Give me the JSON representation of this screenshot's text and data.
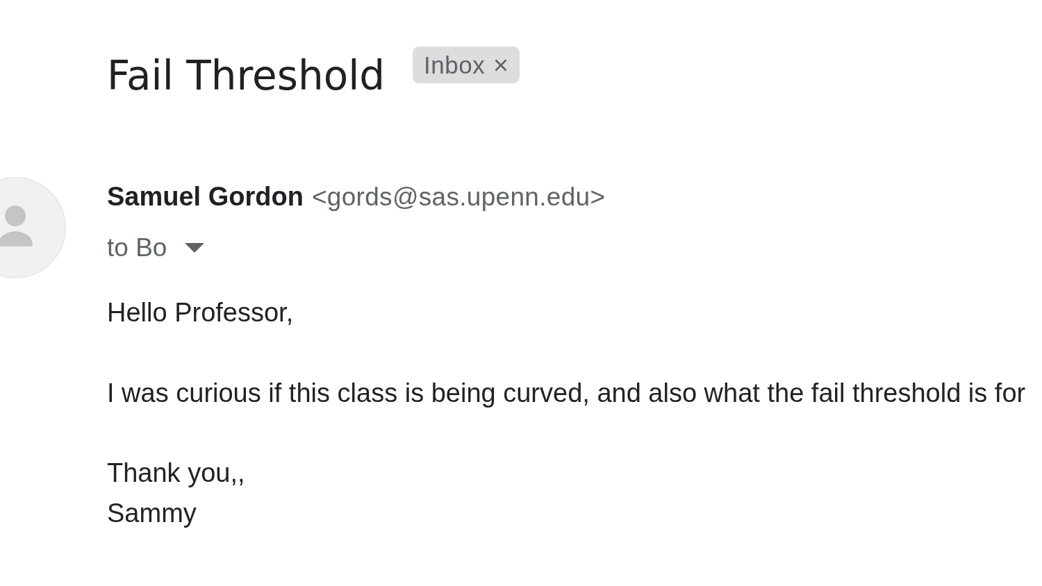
{
  "email": {
    "subject": "Fail Threshold",
    "labels": [
      {
        "text": "Inbox"
      }
    ],
    "sender": {
      "name": "Samuel Gordon",
      "address": "<gords@sas.upenn.edu>"
    },
    "recipients": "to Bo",
    "body": [
      [
        "Hello Professor,"
      ],
      [
        "I was curious if this class is being curved, and also what the fail threshold is for"
      ],
      [
        "Thank you,,",
        "Sammy"
      ]
    ]
  }
}
